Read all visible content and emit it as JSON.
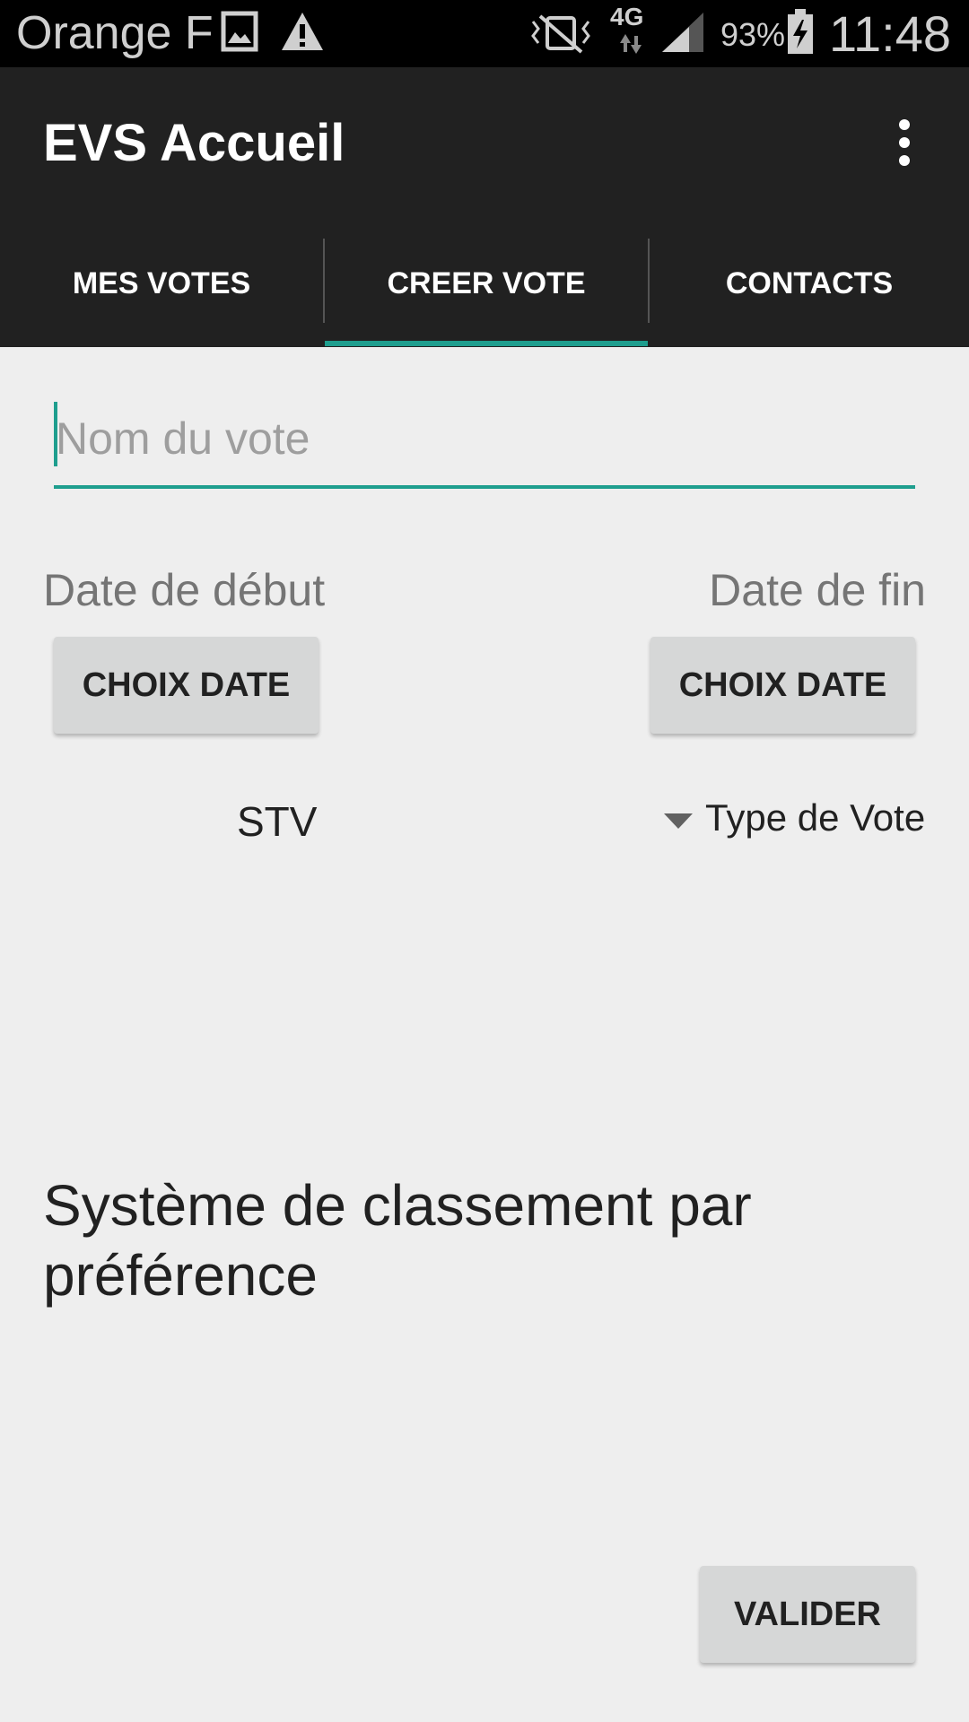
{
  "status_bar": {
    "carrier": "Orange F",
    "network": "4G",
    "battery": "93%",
    "time": "11:48",
    "icons": [
      "image-icon",
      "warning-icon",
      "vibrate-icon",
      "signal-icon",
      "battery-charging-icon"
    ]
  },
  "app_bar": {
    "title": "EVS Accueil",
    "overflow_icon": "more-vert-icon"
  },
  "tabs": [
    {
      "label": "MES VOTES",
      "selected": false
    },
    {
      "label": "CREER VOTE",
      "selected": true
    },
    {
      "label": "CONTACTS",
      "selected": false
    }
  ],
  "form": {
    "name_placeholder": "Nom du vote",
    "name_value": "",
    "start_date_label": "Date de début",
    "end_date_label": "Date de fin",
    "start_date_button": "CHOIX DATE",
    "end_date_button": "CHOIX DATE",
    "vote_type_value": "STV",
    "vote_type_label": "Type de Vote",
    "description": "Système de classement par préférence",
    "submit_button": "VALIDER"
  },
  "colors": {
    "accent": "#1e9e8e",
    "app_bar": "#212121",
    "background": "#eeeeee",
    "button": "#d6d7d7"
  }
}
